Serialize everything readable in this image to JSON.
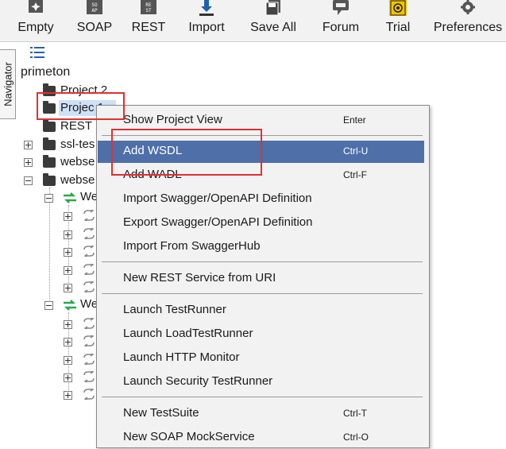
{
  "toolbar": {
    "buttons": [
      {
        "label": "Empty",
        "icon": "empty-project-icon"
      },
      {
        "label": "SOAP",
        "icon": "soap-icon"
      },
      {
        "label": "REST",
        "icon": "rest-icon"
      },
      {
        "label": "Import",
        "icon": "import-icon"
      },
      {
        "label": "Save All",
        "icon": "save-all-icon"
      },
      {
        "label": "Forum",
        "icon": "forum-icon"
      },
      {
        "label": "Trial",
        "icon": "trial-icon"
      },
      {
        "label": "Preferences",
        "icon": "gear-icon"
      }
    ]
  },
  "navigator": {
    "tab_label": "Navigator"
  },
  "tree": {
    "root": "primeton",
    "items": [
      {
        "label": "Project 2"
      },
      {
        "label": "Projec  1"
      },
      {
        "label": "REST P"
      },
      {
        "label": "ssl-tes"
      },
      {
        "label": "webse"
      },
      {
        "label": "webse"
      },
      {
        "label": "We"
      },
      {
        "label": "We"
      }
    ]
  },
  "context_menu": {
    "items": [
      {
        "label": "Show Project View",
        "shortcut": "Enter"
      },
      {
        "label": "Add WSDL",
        "shortcut": "Ctrl-U"
      },
      {
        "label": "Add WADL",
        "shortcut": "Ctrl-F"
      },
      {
        "label": "Import Swagger/OpenAPI Definition",
        "shortcut": ""
      },
      {
        "label": "Export Swagger/OpenAPI Definition",
        "shortcut": ""
      },
      {
        "label": "Import From SwaggerHub",
        "shortcut": ""
      },
      {
        "label": "New REST Service from URI",
        "shortcut": ""
      },
      {
        "label": "Launch TestRunner",
        "shortcut": ""
      },
      {
        "label": "Launch LoadTestRunner",
        "shortcut": ""
      },
      {
        "label": "Launch HTTP Monitor",
        "shortcut": ""
      },
      {
        "label": "Launch Security TestRunner",
        "shortcut": ""
      },
      {
        "label": "New TestSuite",
        "shortcut": "Ctrl-T"
      },
      {
        "label": "New SOAP MockService",
        "shortcut": "Ctrl-O"
      }
    ]
  },
  "colors": {
    "highlight": "#4e6fa8",
    "annotation": "#e03030",
    "interface_green": "#2aa84a"
  }
}
